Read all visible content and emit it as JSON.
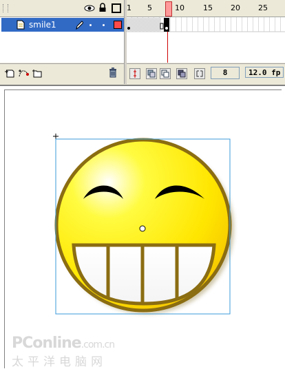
{
  "layer": {
    "name": "smile1"
  },
  "ruler": {
    "ticks": [
      "1",
      "5",
      "10",
      "15",
      "20",
      "25"
    ]
  },
  "frame_toolbar": {
    "current_frame": "8",
    "frame_rate": "12.0 fp"
  },
  "watermark": {
    "line1": "PConline",
    "line1_suffix": ".com.cn",
    "line2": "太平洋电脑网"
  },
  "colors": {
    "selected_layer": "#316ac5",
    "playhead": "#ff8a8a",
    "face_yellow": "#ffe600",
    "face_outline": "#8b6d12"
  },
  "icons": [
    "eye-icon",
    "lock-icon",
    "outline-icon",
    "pencil-icon",
    "add-layer-icon",
    "add-guide-layer-icon",
    "insert-folder-icon",
    "trash-icon",
    "center-frame-icon",
    "onion-skin-icon",
    "onion-outline-icon",
    "edit-multiple-frames-icon",
    "modify-onion-markers-icon"
  ]
}
